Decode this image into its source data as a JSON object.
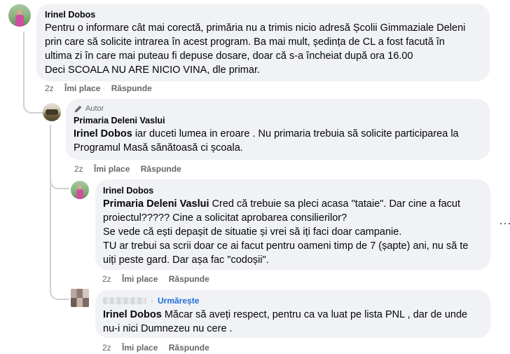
{
  "comments": [
    {
      "author": "Irinel Dobos",
      "lines": [
        "Pentru o informare cât mai corectă, primăria nu a trimis nicio adresă Școlii Gimmaziale Deleni",
        "prin care să solicite intrarea în acest program. Ba mai mult, ședința de CL a fost facută în",
        "ultima zi în care mai puteau fi depuse dosare, doar că s-a încheiat după ora 16.00",
        "Deci SCOALA NU ARE NICIO VINA, dle primar."
      ],
      "time": "2z",
      "like": "Îmi place",
      "reply": "Răspunde"
    },
    {
      "badge": "Autor",
      "author": "Primaria Deleni Vaslui",
      "mention": "Irinel Dobos",
      "lines": [
        " iar duceti lumea in eroare . Nu primaria trebuia să solicite participarea la",
        "Programul Masă sănătoasă ci școala."
      ],
      "time": "2z",
      "like": "Îmi place",
      "reply": "Răspunde"
    },
    {
      "author": "Irinel Dobos",
      "mention": "Primaria Deleni Vaslui",
      "lines": [
        " Cred că trebuie sa pleci acasa \"tataie\". Dar cine a facut",
        "proiectul????? Cine a solicitat aprobarea consilierilor?",
        "Se vede că ești depașit de situatie și vrei să iți faci doar campanie.",
        "TU ar trebui sa scrii doar ce ai facut pentru oameni timp de 7 (șapte) ani, nu să te",
        "uiți peste gard. Dar așa fac \"codoșii\"."
      ],
      "time": "2z",
      "like": "Îmi place",
      "reply": "Răspunde"
    },
    {
      "follow": "Urmărește",
      "mention": "Irinel Dobos",
      "lines": [
        " Măcar să aveți respect, pentru ca va luat pe lista PNL , dar de unde",
        "nu-i nici Dumnezeu nu cere ."
      ],
      "time": "2z",
      "like": "Îmi place",
      "reply": "Răspunde"
    }
  ],
  "more_menu": "⋯",
  "colors": {
    "bubble": "#f0f2f5",
    "meta": "#65676b",
    "follow": "#216fdb"
  }
}
